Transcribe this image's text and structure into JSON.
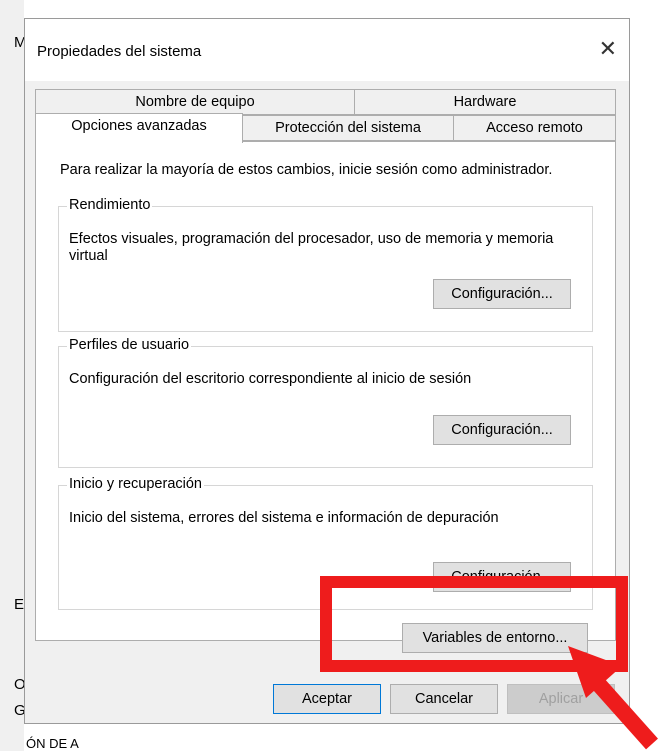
{
  "background": {
    "left_fragments": [
      "M",
      "E",
      "O",
      "G",
      "ÓN DE A"
    ]
  },
  "dialog": {
    "title": "Propiedades del sistema",
    "close_glyph": "✕",
    "tabs_back": [
      "Nombre de equipo",
      "Hardware"
    ],
    "tabs_front": [
      "Opciones avanzadas",
      "Protección del sistema",
      "Acceso remoto"
    ],
    "active_tab": "Opciones avanzadas",
    "intro": "Para realizar la mayoría de estos cambios, inicie sesión como administrador.",
    "groups": [
      {
        "title": "Rendimiento",
        "text": "Efectos visuales, programación del procesador, uso de memoria y memoria virtual",
        "button": "Configuración..."
      },
      {
        "title": "Perfiles de usuario",
        "text": "Configuración del escritorio correspondiente al inicio de sesión",
        "button": "Configuración..."
      },
      {
        "title": "Inicio y recuperación",
        "text": "Inicio del sistema, errores del sistema e información de depuración",
        "button": "Configuración..."
      }
    ],
    "env_button": "Variables de entorno...",
    "footer": {
      "ok": "Aceptar",
      "cancel": "Cancelar",
      "apply": "Aplicar"
    }
  },
  "annotation": {
    "highlight_color": "#ee1c1c"
  }
}
